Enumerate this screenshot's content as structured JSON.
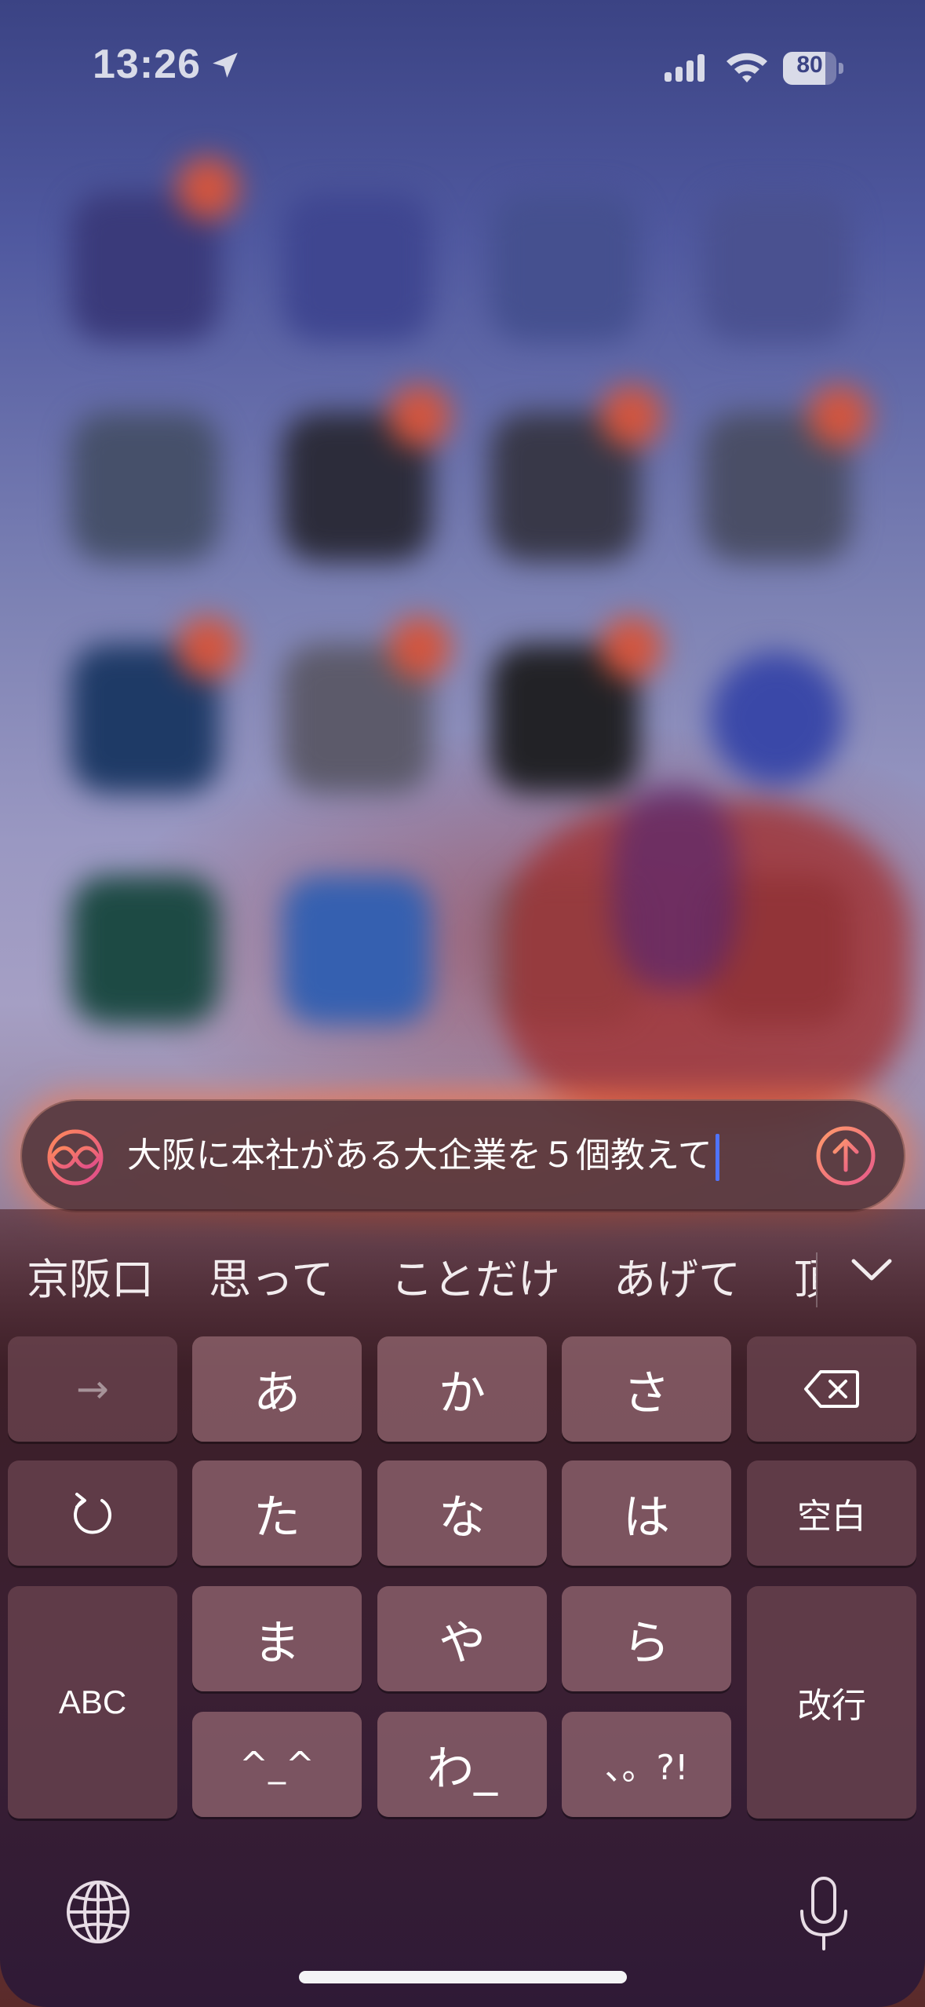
{
  "status_bar": {
    "time": "13:26",
    "battery_percent": "80",
    "battery_level": 0.8
  },
  "prompt": {
    "text": "大阪に本社がある大企業を５個教えて",
    "accent_color": "#ff7a50"
  },
  "candidates": [
    "京阪口",
    "思って",
    "ことだけ",
    "あげて",
    "頂"
  ],
  "keys": {
    "arrow": "→",
    "a": "あ",
    "ka": "か",
    "sa": "さ",
    "backspace": "⌫",
    "undo": "↺",
    "ta": "た",
    "na": "な",
    "ha": "は",
    "space": "空白",
    "abc": "ABC",
    "ma": "ま",
    "ya": "や",
    "ra": "ら",
    "enter": "改行",
    "emoticon": "^_^",
    "wa": "わ_",
    "punct": "、。?!"
  }
}
